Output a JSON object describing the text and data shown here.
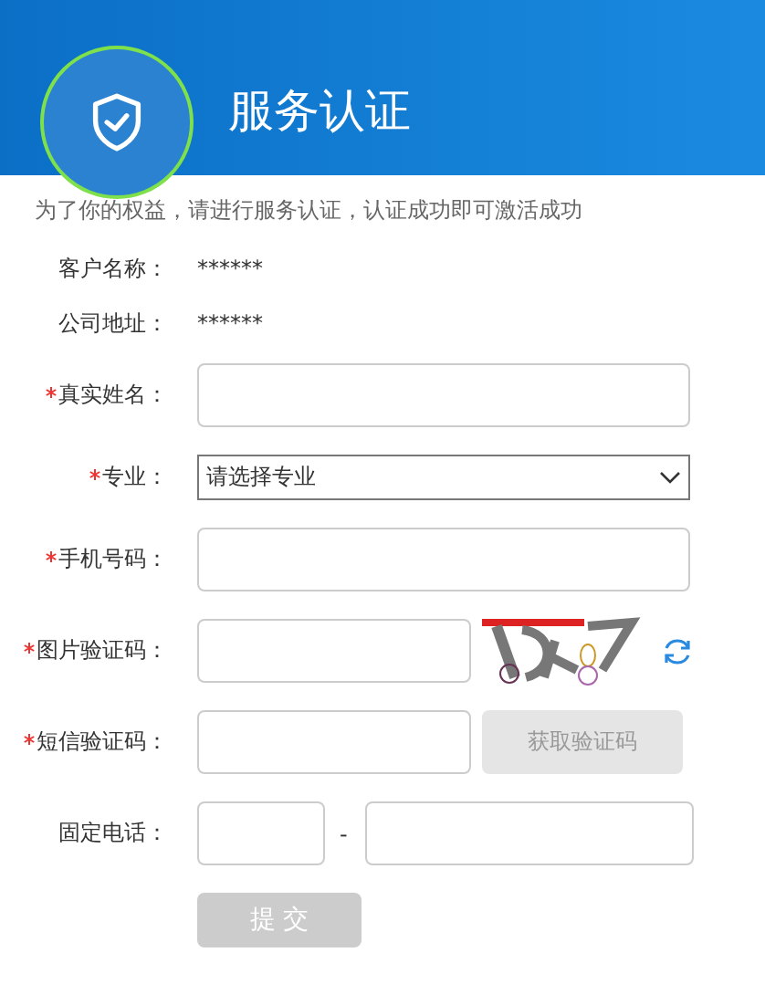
{
  "header": {
    "title": "服务认证"
  },
  "notice": "为了你的权益，请进行服务认证，认证成功即可激活成功",
  "fields": [
    {
      "kind": "static",
      "label": "客户名称：",
      "required": false,
      "value": "******"
    },
    {
      "kind": "static",
      "label": "公司地址：",
      "required": false,
      "value": "******"
    },
    {
      "kind": "input",
      "label": "真实姓名：",
      "required": true
    },
    {
      "kind": "select",
      "label": "专业：",
      "required": true,
      "value": "请选择专业"
    },
    {
      "kind": "input",
      "label": "手机号码：",
      "required": true
    },
    {
      "kind": "captcha",
      "label": "图片验证码：",
      "required": true
    },
    {
      "kind": "sms",
      "label": "短信验证码：",
      "required": true,
      "button": "获取验证码",
      "button_disabled": true
    },
    {
      "kind": "landline",
      "label": "固定电话：",
      "required": false,
      "separator": "-"
    }
  ],
  "submit": {
    "label": "提 交",
    "disabled": true
  }
}
